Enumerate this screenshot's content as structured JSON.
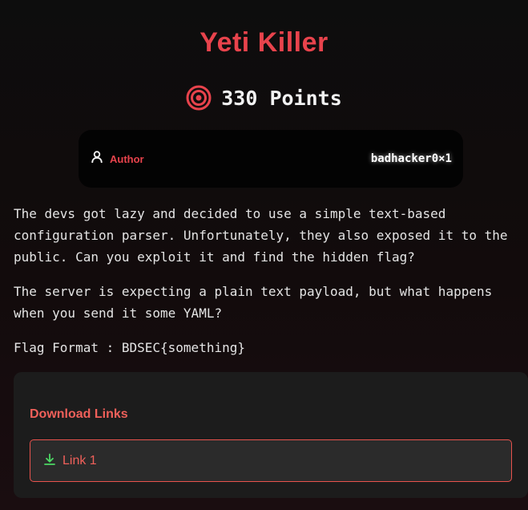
{
  "challenge": {
    "title": "Yeti Killer",
    "points": "330 Points"
  },
  "author": {
    "label": "Author",
    "name": "badhacker0×1"
  },
  "description": {
    "paragraph1": "The devs got lazy and decided to use a simple text-based configuration parser. Unfortunately, they also exposed it to the public. Can you exploit it and find the hidden flag?",
    "paragraph2": "The server is expecting a plain text payload, but what happens when you send it some YAML?",
    "flag_format": "Flag Format : BDSEC{something}"
  },
  "downloads": {
    "title": "Download Links",
    "links": [
      {
        "label": "Link 1",
        "icon": "download-icon"
      }
    ]
  },
  "icons": {
    "points": "target-icon",
    "author": "user-icon"
  },
  "colors": {
    "accent": "#e8434c",
    "link": "#f0605a",
    "download_icon": "#4cd964",
    "background": "#0d0d0d"
  }
}
